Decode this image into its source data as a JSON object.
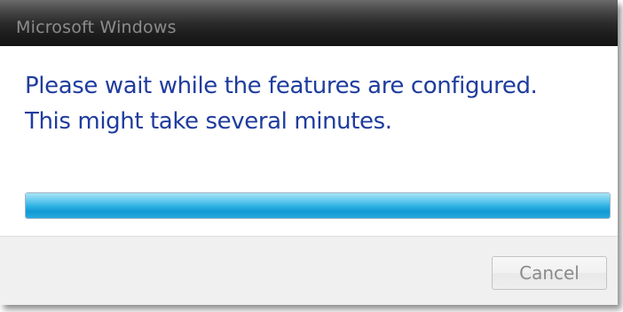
{
  "window": {
    "title": "Microsoft Windows"
  },
  "message": {
    "line1": "Please wait while the features are configured.",
    "line2": "This might take several minutes."
  },
  "progress": {
    "percent": 100,
    "fill_color": "#1ea6dd"
  },
  "buttons": {
    "cancel_label": "Cancel",
    "cancel_enabled": false
  },
  "colors": {
    "message_text": "#1f3c9e",
    "titlebar": "#1c1c1c"
  }
}
